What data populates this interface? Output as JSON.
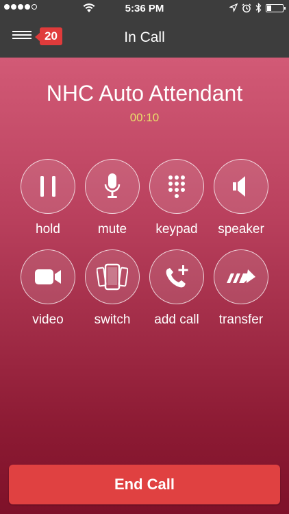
{
  "status_bar": {
    "time": "5:36 PM",
    "signal_dots_filled": 4,
    "signal_dots_total": 5,
    "battery_level_fraction": 0.3
  },
  "nav": {
    "title": "In Call",
    "badge_count": "20"
  },
  "call": {
    "caller_name": "NHC Auto Attendant",
    "duration": "00:10"
  },
  "controls": {
    "hold": {
      "label": "hold",
      "icon": "pause-icon"
    },
    "mute": {
      "label": "mute",
      "icon": "microphone-icon"
    },
    "keypad": {
      "label": "keypad",
      "icon": "keypad-icon"
    },
    "speaker": {
      "label": "speaker",
      "icon": "speaker-icon"
    },
    "video": {
      "label": "video",
      "icon": "video-camera-icon"
    },
    "switch": {
      "label": "switch",
      "icon": "switch-devices-icon"
    },
    "add_call": {
      "label": "add call",
      "icon": "add-call-icon"
    },
    "transfer": {
      "label": "transfer",
      "icon": "transfer-icon"
    }
  },
  "end_call_label": "End Call",
  "colors": {
    "accent": "#e04141",
    "timer": "#e9e06a",
    "bar": "#3d3d3d"
  }
}
